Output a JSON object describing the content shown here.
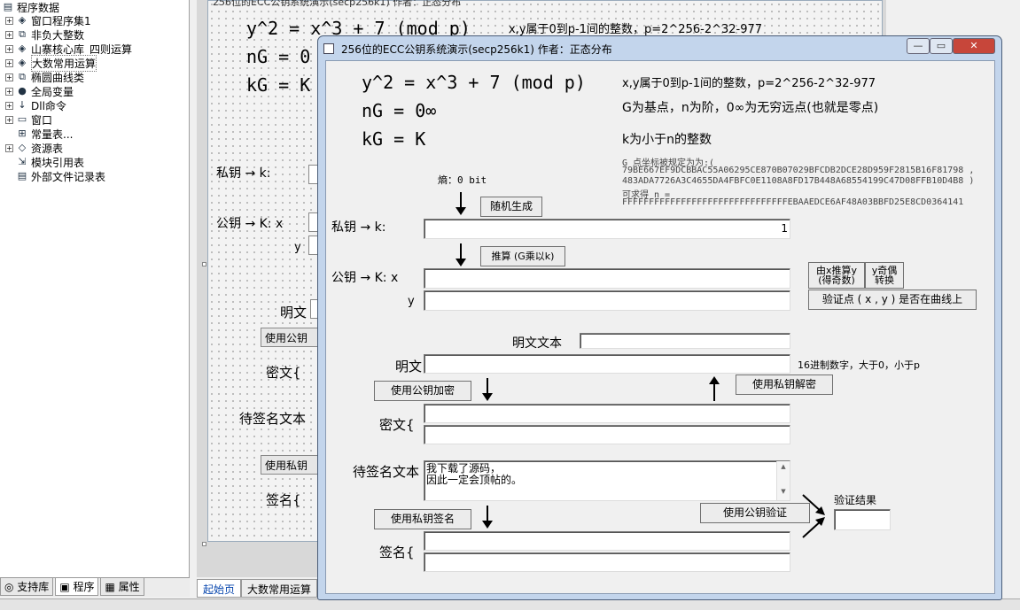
{
  "tree": {
    "items": [
      {
        "label": "程序数据",
        "icon": "app-icon"
      },
      {
        "label": "窗口程序集1",
        "icon": "module-icon"
      },
      {
        "label": "非负大整数",
        "icon": "class-icon"
      },
      {
        "label": "山寨核心库_四则运算",
        "icon": "module-icon"
      },
      {
        "label": "大数常用运算",
        "icon": "module-icon"
      },
      {
        "label": "椭圆曲线类",
        "icon": "class-icon"
      },
      {
        "label": "全局变量",
        "icon": "variable-icon"
      },
      {
        "label": "Dll命令",
        "icon": "dll-icon"
      },
      {
        "label": "窗口",
        "icon": "window-icon"
      },
      {
        "label": "常量表...",
        "icon": "constant-icon"
      },
      {
        "label": "资源表",
        "icon": "resource-icon"
      },
      {
        "label": "模块引用表",
        "icon": "reference-icon"
      },
      {
        "label": "外部文件记录表",
        "icon": "file-icon"
      }
    ]
  },
  "left_tabs": [
    "支持库",
    "程序",
    "属性"
  ],
  "bottom_tabs": [
    "起始页",
    "大数常用运算"
  ],
  "designer": {
    "title": "256位的ECC公钥系统演示(secp256k1) 作者：正态分布",
    "eq1": "y^2 = x^3 + 7 (mod p)",
    "eq1_note": "x,y属于0到p-1间的整数，p=2^256-2^32-977",
    "eq2": "nG = 0",
    "eq3": "kG = K",
    "privkey_label": "私钥 → k:",
    "pubkey_label": "公钥 → K: x",
    "y_label": "y",
    "plain_label": "明文",
    "use_pub_button": "使用公钥",
    "cipher_label": "密文{",
    "sign_text_label": "待签名文本",
    "use_priv_button": "使用私钥",
    "sig_label": "签名{"
  },
  "window": {
    "title": "256位的ECC公钥系统演示(secp256k1) 作者：正态分布",
    "eq1": "y^2 = x^3 + 7 (mod p)",
    "eq2": "nG = 0∞",
    "eq3": "kG = K",
    "note1": "x,y属于0到p-1间的整数，p=2^256-2^32-977",
    "note2": "G为基点，n为阶，0∞为无穷远点(也就是零点)",
    "note3": "k为小于n的整数",
    "g_line1": "G 点坐标被规定为为:(",
    "g_line2": "79BE667EF9DCBBAC55A06295CE870B07029BFCDB2DCE28D959F2815B16F81798 ,",
    "g_line3": "483ADA7726A3C4655DA4FBFC0E1108A8FD17B448A68554199C47D08FFB10D4B8 )",
    "n_line1": "可求得 n =",
    "n_line2": "FFFFFFFFFFFFFFFFFFFFFFFFFFFFFFFEBAAEDCE6AF48A03BBFD25E8CD0364141",
    "entropy": "熵：0 bit",
    "random_button": "随机生成",
    "privkey_label": "私钥 → k:",
    "privkey_value": "1",
    "derive_button": "推算 (G乘以k)",
    "pubkey_label": "公钥 → K: x",
    "y_label": "y",
    "pubkey_x": "",
    "pubkey_y": "",
    "derive_y_button": "由x推算y\n(得奇数)",
    "parity_button": "y奇偶\n转换",
    "verify_point_button": "验证点 ( x , y ) 是否在曲线上",
    "plaintext_label": "明文文本",
    "plaintext_value": "",
    "plain_label": "明文",
    "plain_value": "",
    "plain_hint": "16进制数字，大于0，小于p",
    "encrypt_button": "使用公钥加密",
    "decrypt_button": "使用私钥解密",
    "cipher_label": "密文{",
    "cipher1": "",
    "cipher2": "",
    "sign_text_label": "待签名文本",
    "sign_text": "我下载了源码，\n因此一定会顶帖的。",
    "sign_button": "使用私钥签名",
    "verify_sig_button": "使用公钥验证",
    "verify_result_label": "验证结果",
    "verify_result": "",
    "sig_label": "签名{",
    "sig1": "",
    "sig2": ""
  }
}
